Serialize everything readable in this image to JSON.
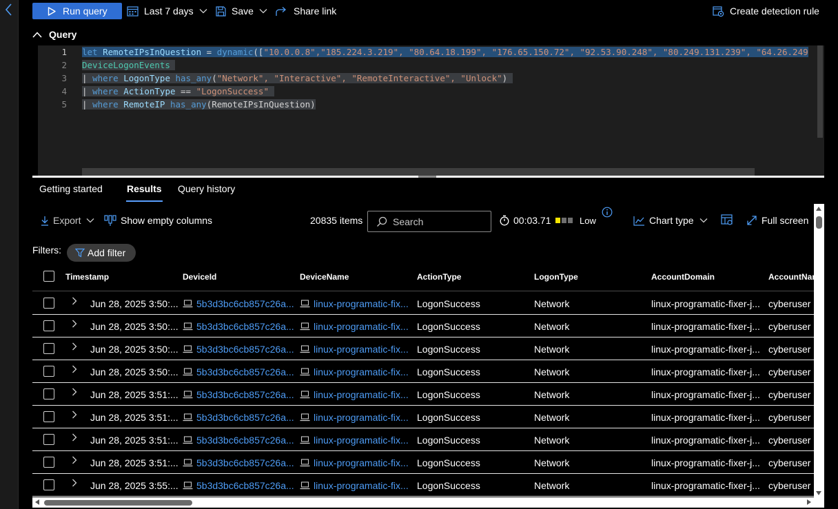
{
  "toolbar": {
    "run_query": "Run query",
    "time_range": "Last 7 days",
    "save": "Save",
    "share_link": "Share link",
    "create_detection_rule": "Create detection rule"
  },
  "query_section": {
    "title": "Query",
    "line_numbers": [
      "1",
      "2",
      "3",
      "4",
      "5"
    ],
    "lines": {
      "l1": {
        "kw_let": "let",
        "var": "RemoteIPsInQuestion",
        "eq": " = ",
        "fn": "dynamic",
        "open": "([",
        "ips": "\"10.0.0.8\",\"185.224.3.219\", \"80.64.18.199\", \"176.65.150.72\", \"92.53.90.248\", \"80.249.131.239\", \"64.26.249"
      },
      "l2": {
        "table": "DeviceLogonEvents"
      },
      "l3": {
        "pipe": "| ",
        "kw": "where",
        "col": "LogonType",
        "op": "has_any",
        "open": "(",
        "args": "\"Network\", \"Interactive\", \"RemoteInteractive\", \"Unlock\"",
        "close": ")"
      },
      "l4": {
        "pipe": "| ",
        "kw": "where",
        "col": "ActionType",
        "op": " == ",
        "value": "\"LogonSuccess\""
      },
      "l5": {
        "pipe": "| ",
        "kw": "where",
        "col": "RemoteIP",
        "op": "has_any",
        "args": "(RemoteIPsInQuestion)"
      }
    }
  },
  "tabs": [
    "Getting started",
    "Results",
    "Query history"
  ],
  "active_tab": "Results",
  "results_toolbar": {
    "export": "Export",
    "show_empty_columns": "Show empty columns",
    "item_count": "20835 items",
    "search_placeholder": "Search",
    "elapsed": "00:03.71",
    "resource_usage": "Low",
    "chart_type": "Chart type",
    "full_screen": "Full screen"
  },
  "filters": {
    "label": "Filters:",
    "add_filter": "Add filter"
  },
  "columns": [
    "Timestamp",
    "DeviceId",
    "DeviceName",
    "ActionType",
    "LogonType",
    "AccountDomain",
    "AccountNam"
  ],
  "rows": [
    {
      "timestamp": "Jun 28, 2025 3:50:...",
      "device_id": "5b3d3bc6cb857c26a...",
      "device_name": "linux-programatic-fix...",
      "action_type": "LogonSuccess",
      "logon_type": "Network",
      "account_domain": "linux-programatic-fixer-j...",
      "account_name": "cyberuser"
    },
    {
      "timestamp": "Jun 28, 2025 3:50:...",
      "device_id": "5b3d3bc6cb857c26a...",
      "device_name": "linux-programatic-fix...",
      "action_type": "LogonSuccess",
      "logon_type": "Network",
      "account_domain": "linux-programatic-fixer-j...",
      "account_name": "cyberuser"
    },
    {
      "timestamp": "Jun 28, 2025 3:50:...",
      "device_id": "5b3d3bc6cb857c26a...",
      "device_name": "linux-programatic-fix...",
      "action_type": "LogonSuccess",
      "logon_type": "Network",
      "account_domain": "linux-programatic-fixer-j...",
      "account_name": "cyberuser"
    },
    {
      "timestamp": "Jun 28, 2025 3:50:...",
      "device_id": "5b3d3bc6cb857c26a...",
      "device_name": "linux-programatic-fix...",
      "action_type": "LogonSuccess",
      "logon_type": "Network",
      "account_domain": "linux-programatic-fixer-j...",
      "account_name": "cyberuser"
    },
    {
      "timestamp": "Jun 28, 2025 3:51:...",
      "device_id": "5b3d3bc6cb857c26a...",
      "device_name": "linux-programatic-fix...",
      "action_type": "LogonSuccess",
      "logon_type": "Network",
      "account_domain": "linux-programatic-fixer-j...",
      "account_name": "cyberuser"
    },
    {
      "timestamp": "Jun 28, 2025 3:51:...",
      "device_id": "5b3d3bc6cb857c26a...",
      "device_name": "linux-programatic-fix...",
      "action_type": "LogonSuccess",
      "logon_type": "Network",
      "account_domain": "linux-programatic-fixer-j...",
      "account_name": "cyberuser"
    },
    {
      "timestamp": "Jun 28, 2025 3:51:...",
      "device_id": "5b3d3bc6cb857c26a...",
      "device_name": "linux-programatic-fix...",
      "action_type": "LogonSuccess",
      "logon_type": "Network",
      "account_domain": "linux-programatic-fixer-j...",
      "account_name": "cyberuser"
    },
    {
      "timestamp": "Jun 28, 2025 3:51:...",
      "device_id": "5b3d3bc6cb857c26a...",
      "device_name": "linux-programatic-fix...",
      "action_type": "LogonSuccess",
      "logon_type": "Network",
      "account_domain": "linux-programatic-fixer-j...",
      "account_name": "cyberuser"
    },
    {
      "timestamp": "Jun 28, 2025 3:55:...",
      "device_id": "5b3d3bc6cb857c26a...",
      "device_name": "linux-programatic-fix...",
      "action_type": "LogonSuccess",
      "logon_type": "Network",
      "account_domain": "linux-programatic-fixer-j...",
      "account_name": "cyberuser"
    }
  ],
  "colors": {
    "accent": "#2f6ed4",
    "link": "#4e9cf5",
    "usage_low": "#f6e500"
  }
}
